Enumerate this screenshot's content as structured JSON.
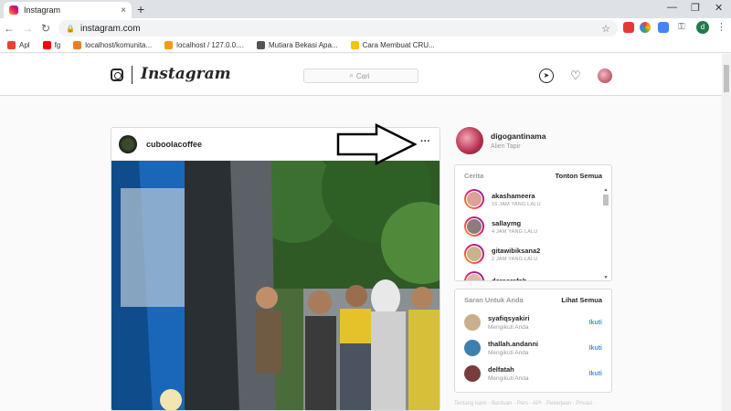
{
  "browser": {
    "tab_title": "Instagram",
    "tab_close": "×",
    "new_tab": "+",
    "url": "instagram.com",
    "profile_initial": "d",
    "bookmarks": [
      {
        "label": "Apl",
        "color": "#ea4335"
      },
      {
        "label": "fg",
        "color": "#ff0000"
      },
      {
        "label": "localhost/komunita...",
        "color": "#e67e22"
      },
      {
        "label": "localhost / 127.0.0....",
        "color": "#f39c12"
      },
      {
        "label": "Mutiara Bekasi Apa...",
        "color": "#555555"
      },
      {
        "label": "Cara Membuat CRU...",
        "color": "#f1c40f"
      }
    ]
  },
  "header": {
    "wordmark": "Instagram",
    "search_placeholder": "Cari"
  },
  "post": {
    "username": "cuboolacoffee",
    "more": "···"
  },
  "me": {
    "username": "digogantinama",
    "fullname": "Alien Tapir"
  },
  "stories": {
    "title": "Cerita",
    "action": "Tonton Semua",
    "items": [
      {
        "name": "akashameera",
        "time": "16 JAM YANG LALU",
        "color": "#d9a39a"
      },
      {
        "name": "sallaymg",
        "time": "4 JAM YANG LALU",
        "color": "#8a7d7a"
      },
      {
        "name": "gitawibiksana2",
        "time": "2 JAM YANG LALU",
        "color": "#c9b38a"
      },
      {
        "name": "daraarafah",
        "time": "",
        "color": "#e0b8a8"
      }
    ]
  },
  "suggestions": {
    "title": "Saran Untuk Anda",
    "action": "Lihat Semua",
    "items": [
      {
        "name": "syafiqsyakiri",
        "sub": "Mengikuti Anda",
        "follow": "Ikuti",
        "color": "#c8b08c"
      },
      {
        "name": "thallah.andanni",
        "sub": "Mengikuti Anda",
        "follow": "Ikuti",
        "color": "#3e7fae"
      },
      {
        "name": "delfatah",
        "sub": "Mengikuti Anda",
        "follow": "Ikuti",
        "color": "#7a3b3b"
      }
    ]
  },
  "footer": "Tentang kami · Bantuan · Pers · API · Pekerjaan · Privasi ·"
}
